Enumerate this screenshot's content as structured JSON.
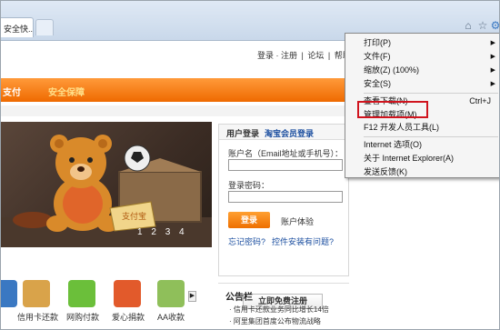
{
  "browser": {
    "tab_title": "安全快...",
    "icons": [
      "home-icon",
      "star-icon",
      "gear-icon"
    ]
  },
  "site": {
    "top_links": [
      "登录 · 注册",
      "|",
      "论坛",
      "|",
      "帮助中"
    ],
    "nav": [
      {
        "label": "支付"
      },
      {
        "label": "安全保障"
      }
    ],
    "carousel_pages": [
      "1",
      "2",
      "3",
      "4"
    ],
    "banner_tag": "支付宝"
  },
  "login": {
    "tab_user": "用户登录",
    "tab_taobao": "淘宝会员登录",
    "account_label": "账户名（Email地址或手机号）：",
    "password_label": "登录密码：",
    "login_button": "登录",
    "experience": "账户体验",
    "forgot_password": "忘记密码?",
    "install_problem": "控件安装有问题?",
    "register_button": "立即免费注册"
  },
  "notice": {
    "title": "公告栏",
    "items": [
      "信用卡还款业务同比增长14倍",
      "阿里集团首度公布物流战略"
    ]
  },
  "apps": [
    {
      "name": "信用卡还款",
      "color": "#d9a34a"
    },
    {
      "name": "网购付款",
      "color": "#6bbf3a"
    },
    {
      "name": "爱心捐款",
      "color": "#e25a2b"
    },
    {
      "name": "AA收款",
      "color": "#8fbf5a"
    }
  ],
  "tools_menu": {
    "items": [
      {
        "label": "打印(P)",
        "arrow": true
      },
      {
        "label": "文件(F)",
        "arrow": true
      },
      {
        "label": "缩放(Z) (100%)",
        "arrow": true
      },
      {
        "label": "安全(S)",
        "arrow": true
      },
      {
        "label": "查看下载(N)",
        "shortcut": "Ctrl+J"
      },
      {
        "label": "管理加载项(M)"
      },
      {
        "label": "F12 开发人员工具(L)"
      },
      {
        "label": "Internet 选项(O)"
      },
      {
        "label": "关于 Internet Explorer(A)"
      },
      {
        "label": "发送反馈(K)"
      }
    ],
    "highlight_color": "#d0141e"
  }
}
